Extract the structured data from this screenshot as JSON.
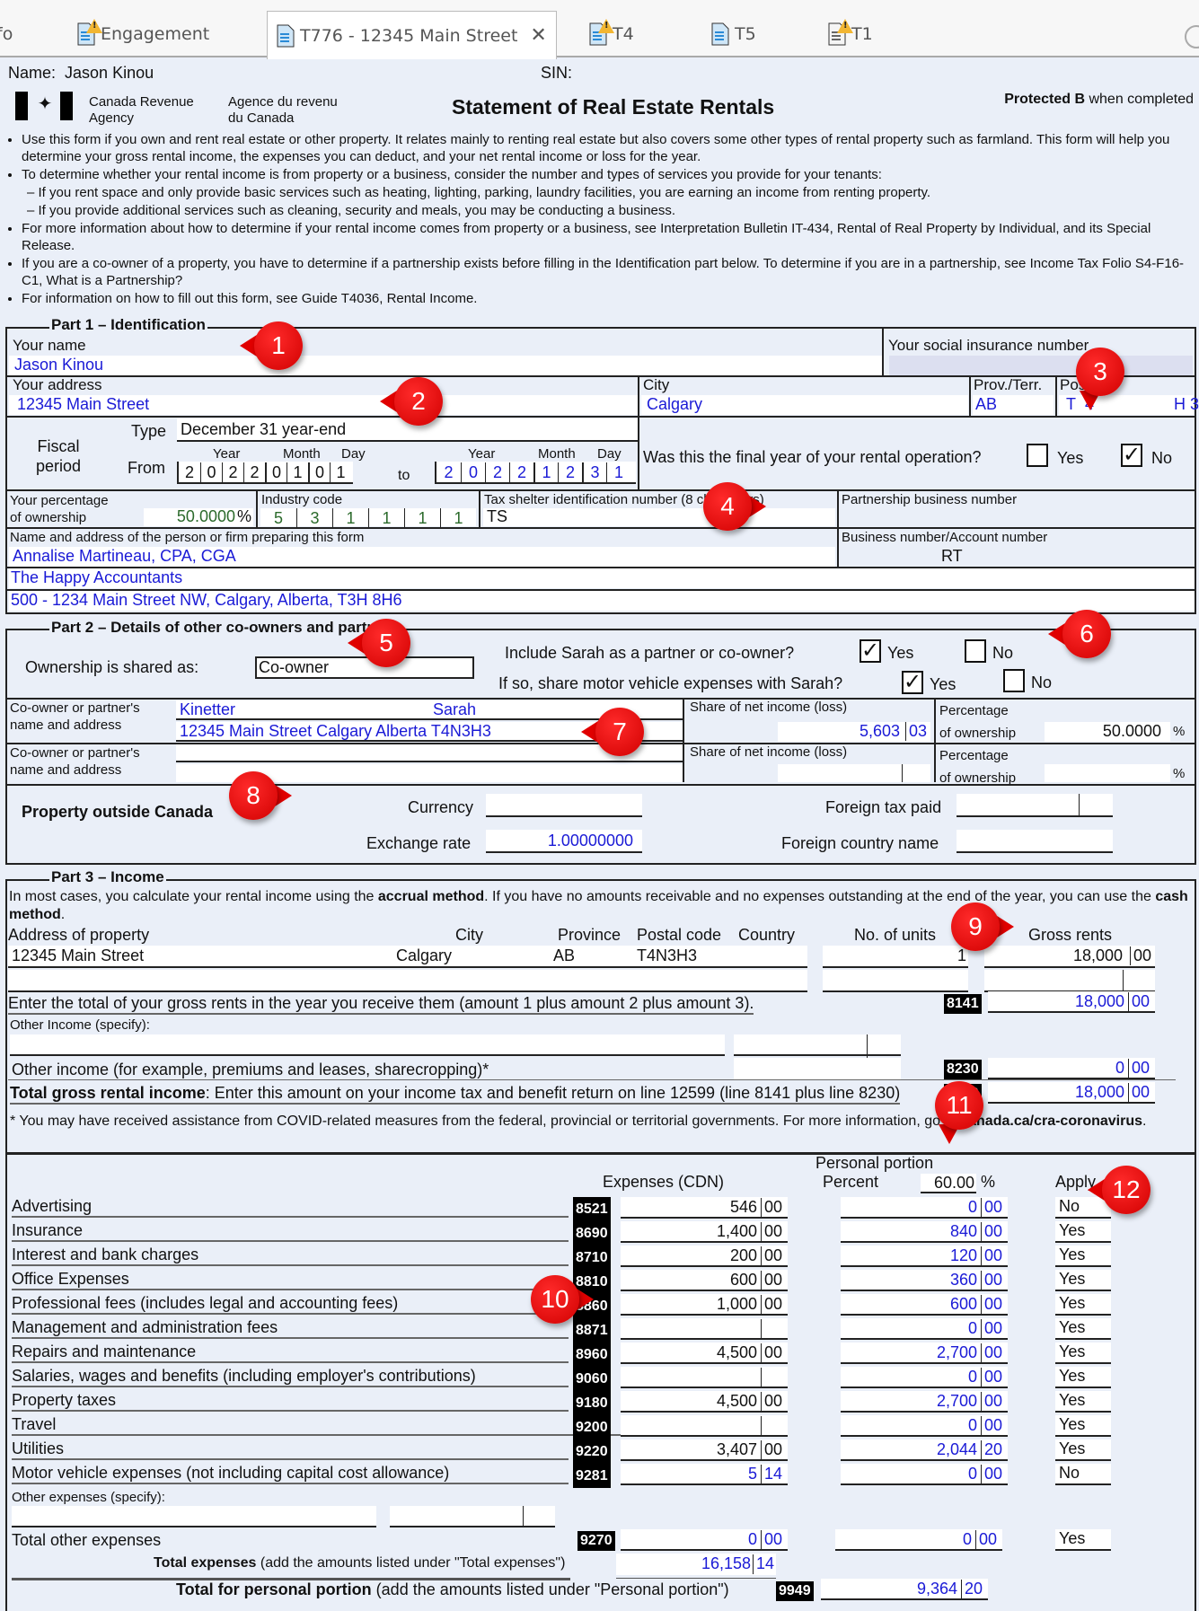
{
  "tabs": [
    {
      "label": "fo",
      "icon": "none",
      "active": false
    },
    {
      "label": "Engagement",
      "icon": "document-warning-icon",
      "active": false
    },
    {
      "label": "T776 - 12345 Main Street",
      "icon": "document-icon",
      "active": true,
      "close": "✕"
    },
    {
      "label": "T4",
      "icon": "document-warning-icon",
      "active": false
    },
    {
      "label": "T5",
      "icon": "document-icon",
      "active": false
    },
    {
      "label": "T1",
      "icon": "document-warning-icon",
      "active": false
    }
  ],
  "header": {
    "name_label": "Name:",
    "name_value": "Jason Kinou",
    "sin_label": "SIN:",
    "agency_en_1": "Canada Revenue",
    "agency_en_2": "Agency",
    "agency_fr_1": "Agence du revenu",
    "agency_fr_2": "du Canada",
    "title": "Statement of Real Estate Rentals",
    "protected_bold": "Protected B",
    "protected_rest": " when completed"
  },
  "instructions": [
    "Use this form if you own and rent real estate or other property. It relates mainly to renting real estate but also covers some other types of rental property such as farmland. This form will help you determine your gross rental income, the expenses you can deduct, and your net rental income or loss for the year.",
    "To determine whether your rental income is from property or a business, consider the number and types of services you provide for your tenants:",
    "– If you rent space and only provide basic services such as heating, lighting, parking, laundry facilities, you are earning an income from renting property.",
    "– If you provide additional services such as cleaning, security and meals, you may be conducting a business.",
    "For more information about how to determine if your rental income comes from property or a business, see Interpretation Bulletin IT-434, Rental of Real Property by Individual, and its Special Release.",
    "If you are a co-owner of a property, you have to determine if a partnership exists before filling in the Identification part below. To determine if you are in a partnership, see Income Tax Folio S4-F16-C1, What is a Partnership?",
    "For information on how to fill out this form, see Guide T4036, Rental Income."
  ],
  "part1": {
    "legend": "Part 1 – Identification",
    "your_name_label": "Your name",
    "your_name": "Jason Kinou",
    "sin_label": "Your social insurance number",
    "address_label": "Your address",
    "address": "12345 Main Street",
    "city_label": "City",
    "city": "Calgary",
    "prov_label": "Prov./Terr.",
    "prov": "AB",
    "postal_label": "Postal",
    "postal_visible": "T 4 ... H 3",
    "fiscal_label_1": "Fiscal",
    "fiscal_label_2": "period",
    "type_label": "Type",
    "type_value": "December 31 year-end",
    "from_label": "From",
    "to_label": "to",
    "year_label": "Year",
    "month_label": "Month",
    "day_label": "Day",
    "from_date": [
      "2",
      "0",
      "2",
      "2",
      "0",
      "1",
      "0",
      "1"
    ],
    "to_date": [
      "2",
      "0",
      "2",
      "2",
      "1",
      "2",
      "3",
      "1"
    ],
    "final_year_question": "Was this the final year of your rental operation?",
    "final_yes_label": "Yes",
    "final_no_label": "No",
    "final_yes_checked": false,
    "final_no_checked": true,
    "pct_label_1": "Your percentage",
    "pct_label_2": "of ownership",
    "pct_value": "50.0000",
    "pct_sign": "%",
    "industry_label": "Industry code",
    "industry_code": [
      "5",
      "3",
      "1",
      "1",
      "1",
      "1"
    ],
    "tax_shelter_label": "Tax shelter identification number (8 characters)",
    "tax_shelter_value": "TS",
    "partnership_bn_label": "Partnership business number",
    "preparer_label": "Name and address of the person or firm preparing this form",
    "preparer_name": "Annalise Martineau, CPA, CGA",
    "preparer_firm": "The Happy Accountants",
    "preparer_address": "500 - 1234 Main Street NW, Calgary, Alberta, T3H 8H6",
    "bn_label": "Business number/Account number",
    "bn_value": "RT"
  },
  "part2": {
    "legend": "Part 2 – Details of other co-owners and partners",
    "ownership_label": "Ownership is shared as:",
    "ownership_value": "Co-owner",
    "include_question": "Include Sarah as a partner or co-owner?",
    "include_yes_checked": true,
    "include_no_checked": false,
    "share_mv_question": "If so, share motor vehicle expenses with Sarah?",
    "share_mv_yes_checked": true,
    "share_mv_no_checked": false,
    "yes_label": "Yes",
    "no_label": "No",
    "coowner_label_1": "Co-owner or partner's",
    "coowner_label_2": "name and address",
    "coowner1_last": "Kinetter",
    "coowner1_first": "Sarah",
    "coowner1_address": "12345 Main Street Calgary Alberta T4N3H3",
    "share_label": "Share of net income (loss)",
    "coowner1_share_dollars": "5,603",
    "coowner1_share_cents": "03",
    "pct_label_1": "Percentage",
    "pct_label_2": "of ownership",
    "coowner1_pct": "50.0000",
    "pct_sign": "%"
  },
  "foreign": {
    "title": "Property outside Canada",
    "currency_label": "Currency",
    "currency_value": "",
    "exchange_label": "Exchange rate",
    "exchange_value": "1.00000000",
    "foreign_tax_label": "Foreign tax paid",
    "foreign_country_label": "Foreign country name"
  },
  "part3": {
    "legend": "Part 3 – Income",
    "intro_1": "In most cases, you calculate your rental income using the ",
    "intro_bold_1": "accrual method",
    "intro_2": ". If you have no amounts receivable and no expenses outstanding at the end of the year, you can use the ",
    "intro_bold_2": "cash method",
    "intro_3": ".",
    "headers": {
      "address": "Address of property",
      "city": "City",
      "province": "Province",
      "postal": "Postal code",
      "country": "Country",
      "units": "No. of units",
      "gross": "Gross rents"
    },
    "property": {
      "address": "12345 Main Street",
      "city": "Calgary",
      "province": "AB",
      "postal": "T4N3H3",
      "country": "",
      "units": "1",
      "gross_dollars": "18,000",
      "gross_cents": "00"
    },
    "total_gross_label": "Enter the total of your gross rents in the year you receive them (amount 1 plus amount 2 plus amount 3).",
    "line_8141": "8141",
    "total_gross_dollars": "18,000",
    "total_gross_cents": "00",
    "other_income_specify": "Other Income (specify):",
    "other_income_label": "Other income (for example, premiums and leases, sharecropping)*",
    "line_8230": "8230",
    "other_income_dollars": "0",
    "other_income_cents": "00",
    "total_rental_bold": "Total gross rental income",
    "total_rental_rest": ": Enter this amount on your income tax and benefit return on line 12599 (line 8141 plus line 8230)",
    "line_8299": "8299",
    "total_rental_dollars": "18,000",
    "total_rental_cents": "00",
    "covid_note": "* You may have received assistance from COVID-related measures from the federal, provincial or territorial governments. For more information, go to ",
    "covid_link": "canada.ca/cra-coronavirus",
    "covid_end": "."
  },
  "expenses": {
    "col_expenses": "Expenses (CDN)",
    "col_personal": "Personal portion",
    "col_percent": "Percent",
    "percent_value": "60.00",
    "percent_sign": "%",
    "col_apply": "Apply",
    "rows": [
      {
        "label": "Advertising",
        "code": "8521",
        "exp_d": "546",
        "exp_c": "00",
        "per_d": "0",
        "per_c": "00",
        "apply": "No"
      },
      {
        "label": "Insurance",
        "code": "8690",
        "exp_d": "1,400",
        "exp_c": "00",
        "per_d": "840",
        "per_c": "00",
        "apply": "Yes"
      },
      {
        "label": "Interest and bank charges",
        "code": "8710",
        "exp_d": "200",
        "exp_c": "00",
        "per_d": "120",
        "per_c": "00",
        "apply": "Yes"
      },
      {
        "label": "Office Expenses",
        "code": "8810",
        "exp_d": "600",
        "exp_c": "00",
        "per_d": "360",
        "per_c": "00",
        "apply": "Yes"
      },
      {
        "label": "Professional fees (includes legal and accounting fees)",
        "code": "8860",
        "exp_d": "1,000",
        "exp_c": "00",
        "per_d": "600",
        "per_c": "00",
        "apply": "Yes"
      },
      {
        "label": "Management and administration fees",
        "code": "8871",
        "exp_d": "",
        "exp_c": "",
        "per_d": "0",
        "per_c": "00",
        "apply": "Yes"
      },
      {
        "label": "Repairs and maintenance",
        "code": "8960",
        "exp_d": "4,500",
        "exp_c": "00",
        "per_d": "2,700",
        "per_c": "00",
        "apply": "Yes"
      },
      {
        "label": "Salaries, wages and benefits (including employer's contributions)",
        "code": "9060",
        "exp_d": "",
        "exp_c": "",
        "per_d": "0",
        "per_c": "00",
        "apply": "Yes"
      },
      {
        "label": "Property taxes",
        "code": "9180",
        "exp_d": "4,500",
        "exp_c": "00",
        "per_d": "2,700",
        "per_c": "00",
        "apply": "Yes"
      },
      {
        "label": "Travel",
        "code": "9200",
        "exp_d": "",
        "exp_c": "",
        "per_d": "0",
        "per_c": "00",
        "apply": "Yes"
      },
      {
        "label": "Utilities",
        "code": "9220",
        "exp_d": "3,407",
        "exp_c": "00",
        "per_d": "2,044",
        "per_c": "20",
        "apply": "Yes"
      },
      {
        "label": "Motor vehicle expenses (not including capital cost allowance)",
        "code": "9281",
        "exp_d": "5",
        "exp_c": "14",
        "per_d": "0",
        "per_c": "00",
        "apply": "No",
        "exp_blue": true
      }
    ],
    "other_specify": "Other expenses (specify):",
    "total_other_label": "Total other expenses",
    "line_9270": "9270",
    "total_other_d": "0",
    "total_other_c": "00",
    "total_other_per_d": "0",
    "total_other_per_c": "00",
    "total_other_apply": "Yes",
    "total_exp_bold": "Total expenses",
    "total_exp_rest": " (add the amounts listed under \"Total expenses\")",
    "total_exp_d": "16,158",
    "total_exp_c": "14",
    "total_personal_bold": "Total for personal portion",
    "total_personal_rest": " (add the amounts listed under \"Personal portion\")",
    "line_9949": "9949",
    "total_personal_d": "9,364",
    "total_personal_c": "20"
  },
  "callouts": [
    "1",
    "2",
    "3",
    "4",
    "5",
    "6",
    "7",
    "8",
    "9",
    "10",
    "11",
    "12"
  ]
}
